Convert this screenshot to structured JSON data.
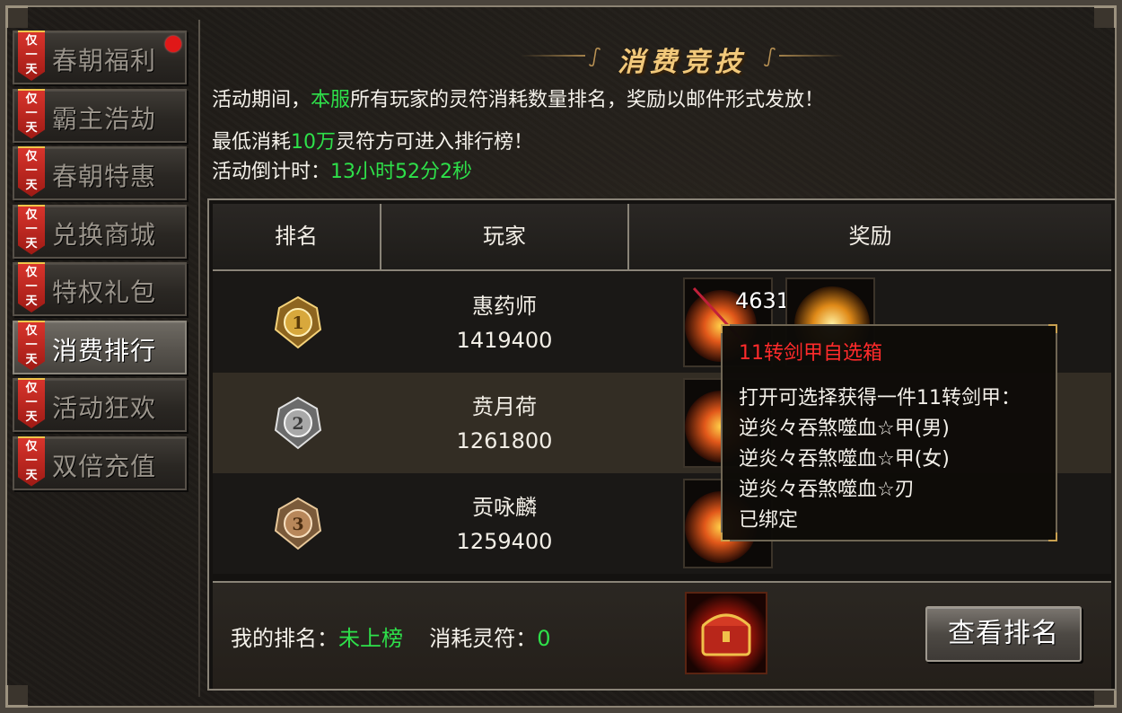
{
  "sidebar": {
    "items": [
      {
        "badge": "仅一天",
        "label": "春朝福利",
        "active": false,
        "has_dot": true
      },
      {
        "badge": "仅一天",
        "label": "霸主浩劫",
        "active": false,
        "has_dot": false
      },
      {
        "badge": "仅一天",
        "label": "春朝特惠",
        "active": false,
        "has_dot": false
      },
      {
        "badge": "仅一天",
        "label": "兑换商城",
        "active": false,
        "has_dot": false
      },
      {
        "badge": "仅一天",
        "label": "特权礼包",
        "active": false,
        "has_dot": false
      },
      {
        "badge": "仅一天",
        "label": "消费排行",
        "active": true,
        "has_dot": false
      },
      {
        "badge": "仅一天",
        "label": "活动狂欢",
        "active": false,
        "has_dot": false
      },
      {
        "badge": "仅一天",
        "label": "双倍充值",
        "active": false,
        "has_dot": false
      }
    ]
  },
  "panel": {
    "title": "消费竞技",
    "line1_a": "活动期间，",
    "line1_b": "本服",
    "line1_c": "所有玩家的灵符消耗数量排名，奖励以邮件形式发放！",
    "line2_a": "最低消耗",
    "line2_b": "10万",
    "line2_c": "灵符方可进入排行榜！",
    "line3_a": "活动倒计时：",
    "line3_b": "13小时52分2秒"
  },
  "table": {
    "headers": {
      "rank": "排名",
      "player": "玩家",
      "reward": "奖励"
    },
    "rows": [
      {
        "rank": "1",
        "name": "惠药师",
        "score": "1419400",
        "reward_count": "4631"
      },
      {
        "rank": "2",
        "name": "贲月荷",
        "score": "1261800",
        "reward_count": ""
      },
      {
        "rank": "3",
        "name": "贡咏麟",
        "score": "1259400",
        "reward_count": ""
      }
    ]
  },
  "footer": {
    "my_rank_label": "我的排名：",
    "my_rank_value": "未上榜",
    "consume_label": "消耗灵符：",
    "consume_value": "0",
    "view_button": "查看排名"
  },
  "tooltip": {
    "title": "11转剑甲自选箱",
    "desc": "打开可选择获得一件11转剑甲：",
    "options": [
      "逆炎々吞煞噬血☆甲(男)",
      "逆炎々吞煞噬血☆甲(女)",
      "逆炎々吞煞噬血☆刃"
    ],
    "bound": "已绑定"
  },
  "colors": {
    "highlight_green": "#2ee04a",
    "tooltip_title_red": "#ff2b2b",
    "bound_yellow": "#f0d22e",
    "notification_red": "#e01818"
  }
}
